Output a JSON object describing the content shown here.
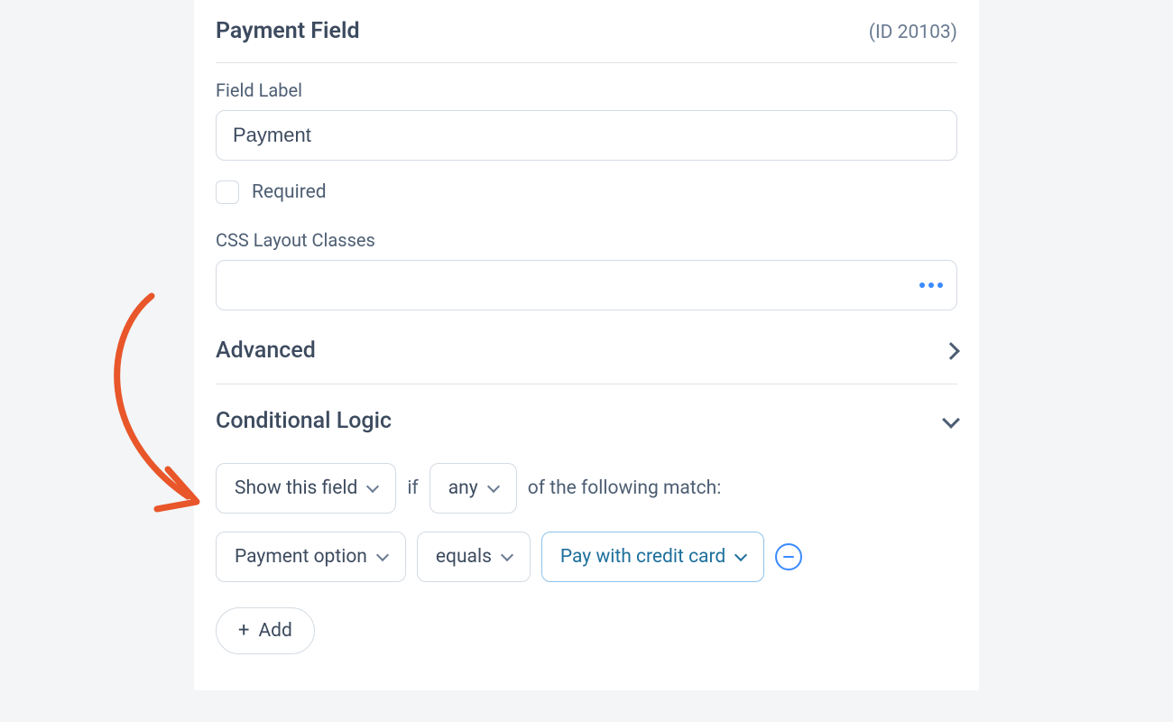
{
  "header": {
    "title": "Payment Field",
    "id_label": "(ID 20103)"
  },
  "field_label": {
    "label": "Field Label",
    "value": "Payment"
  },
  "required": {
    "label": "Required",
    "checked": false
  },
  "css_classes": {
    "label": "CSS Layout Classes",
    "value": ""
  },
  "sections": {
    "advanced": "Advanced",
    "conditional": "Conditional Logic"
  },
  "logic": {
    "action": "Show this field",
    "if": "if",
    "match": "any",
    "tail": "of the following match:",
    "rule": {
      "field": "Payment option",
      "operator": "equals",
      "value": "Pay with credit card"
    },
    "add": "Add"
  }
}
